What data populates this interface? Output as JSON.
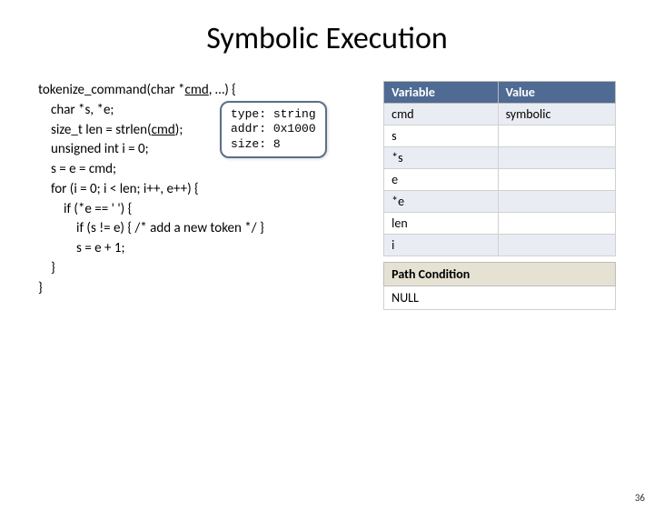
{
  "title": "Symbolic Execution",
  "code": {
    "l0a": "tokenize_command(char *",
    "l0b": "cmd",
    "l0c": ", …) {",
    "l1": "char *s, *e;",
    "l2a": "size_t len = strlen(",
    "l2b": "cmd",
    "l2c": ");",
    "l3": "unsigned int i = 0;",
    "l4": "s = e = cmd;",
    "l5": "for (i = 0; i < len; i++, e++) {",
    "l6": "if (*e == ' ') {",
    "l7": "if (s != e) { /* add a new token */ }",
    "l8": "s = e + 1;",
    "l9": "}",
    "l10": "}"
  },
  "tooltip": {
    "r0k": "type:",
    "r0v": "string",
    "r1k": "addr:",
    "r1v": "0x1000",
    "r2k": "size:",
    "r2v": "8"
  },
  "vars": {
    "h0": "Variable",
    "h1": "Value",
    "rows": [
      {
        "k": "cmd",
        "v": "symbolic"
      },
      {
        "k": "s",
        "v": ""
      },
      {
        "k": "*s",
        "v": ""
      },
      {
        "k": "e",
        "v": ""
      },
      {
        "k": "*e",
        "v": ""
      },
      {
        "k": "len",
        "v": ""
      },
      {
        "k": "i",
        "v": ""
      }
    ]
  },
  "pc": {
    "header": "Path Condition",
    "row0": "NULL"
  },
  "pagenum": "36"
}
